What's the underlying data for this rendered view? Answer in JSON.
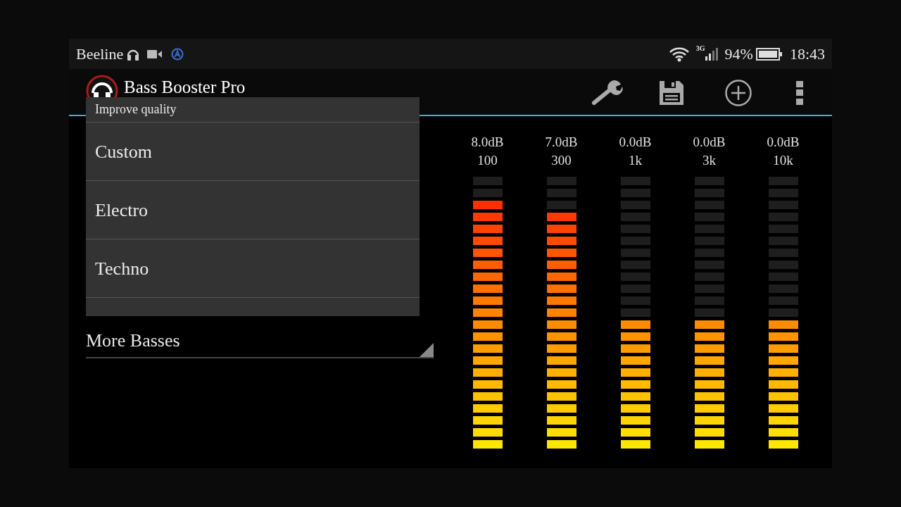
{
  "status_bar": {
    "carrier": "Beeline",
    "network": "3G",
    "battery": "94%",
    "time": "18:43"
  },
  "app_bar": {
    "title": "Bass Booster Pro"
  },
  "preset_menu": {
    "items": [
      {
        "label": "Improve quality"
      },
      {
        "label": "Custom"
      },
      {
        "label": "Electro"
      },
      {
        "label": "Techno"
      }
    ]
  },
  "preset_dropdown": {
    "value": "More Basses"
  },
  "equalizer": {
    "bands": [
      {
        "gain": "8.0dB",
        "frequency": "100",
        "level": 0.913
      },
      {
        "gain": "7.0dB",
        "frequency": "300",
        "level": 0.87
      },
      {
        "gain": "0.0dB",
        "frequency": "1k",
        "level": 0.478
      },
      {
        "gain": "0.0dB",
        "frequency": "3k",
        "level": 0.478
      },
      {
        "gain": "0.0dB",
        "frequency": "10k",
        "level": 0.478
      }
    ]
  }
}
